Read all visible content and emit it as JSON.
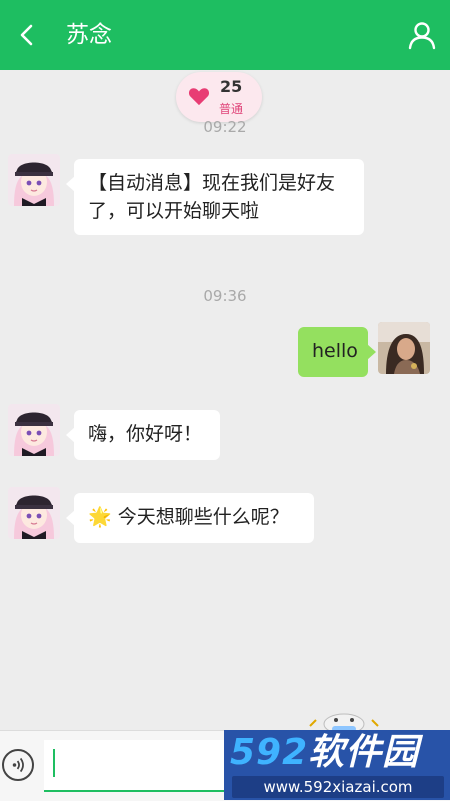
{
  "header": {
    "title": "苏念",
    "back_icon": "chevron-left-icon",
    "profile_icon": "user-icon",
    "background": "#1ebe61"
  },
  "intimacy": {
    "icon": "heart-icon",
    "value": "25",
    "level": "普通"
  },
  "messages": [
    {
      "type": "time",
      "text": "09:22"
    },
    {
      "type": "received",
      "avatar": "anime-girl-avatar",
      "lines": [
        "【自动消息】现在我们是好友",
        "了，可以开始聊天啦"
      ]
    },
    {
      "type": "time",
      "text": "09:36"
    },
    {
      "type": "sent",
      "avatar": "user-photo-avatar",
      "text": "hello"
    },
    {
      "type": "received",
      "avatar": "anime-girl-avatar",
      "text": "嗨，你好呀！"
    },
    {
      "type": "received",
      "avatar": "anime-girl-avatar",
      "emoji": "🌟",
      "text": "今天想聊些什么呢？"
    }
  ],
  "input_bar": {
    "voice_icon": "voice-wave-icon",
    "input_value": "",
    "accent": "#1ebe61"
  },
  "watermark": {
    "digits": "592",
    "brand": "软件园",
    "url": "www.592xiazai.com"
  },
  "colors": {
    "sent_bubble": "#94e05f",
    "received_bubble": "#ffffff",
    "background": "#ededed"
  }
}
